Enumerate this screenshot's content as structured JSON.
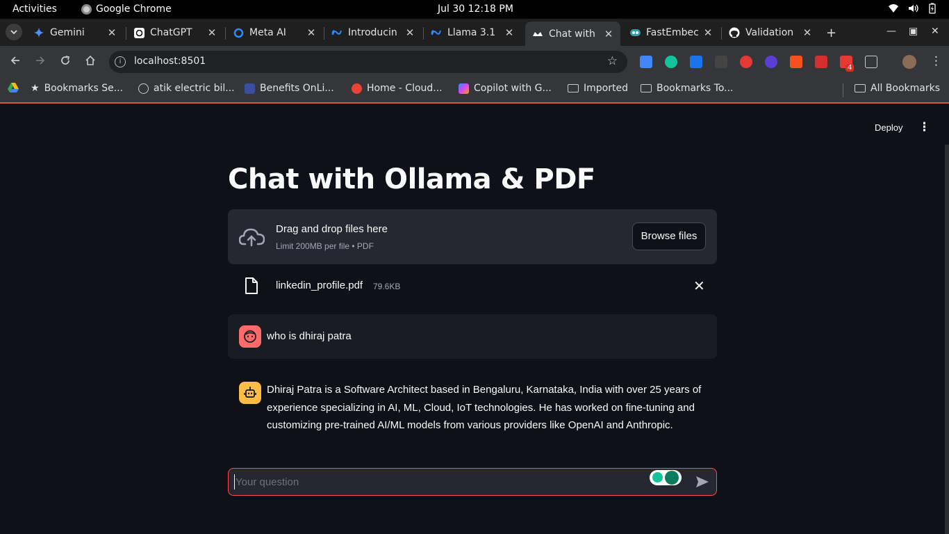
{
  "system": {
    "activities": "Activities",
    "app_name": "Google Chrome",
    "clock": "Jul 30  12:18 PM"
  },
  "browser": {
    "tabs": [
      {
        "title": "Gemini",
        "icon": "gemini-icon"
      },
      {
        "title": "ChatGPT",
        "icon": "chatgpt-icon"
      },
      {
        "title": "Meta AI",
        "icon": "meta-ai-icon"
      },
      {
        "title": "Introducin",
        "icon": "meta-icon"
      },
      {
        "title": "Llama 3.1",
        "icon": "meta-icon"
      },
      {
        "title": "Chat with",
        "icon": "streamlit-icon",
        "active": true
      },
      {
        "title": "FastEmbec",
        "icon": "fastembed-icon"
      },
      {
        "title": "Validation",
        "icon": "github-icon"
      }
    ],
    "url": "localhost:8501",
    "extension_badge": "4",
    "bookmarks": [
      {
        "label": "Bookmarks Se...",
        "icon": "star-icon"
      },
      {
        "label": "atik electric bil...",
        "icon": "globe-icon"
      },
      {
        "label": "Benefits OnLi...",
        "icon": "benefits-icon"
      },
      {
        "label": "Home - Cloud...",
        "icon": "google-cloud-icon"
      },
      {
        "label": "Copilot with G...",
        "icon": "copilot-icon"
      },
      {
        "label": "Imported",
        "icon": "folder-icon"
      },
      {
        "label": "Bookmarks To...",
        "icon": "folder-icon"
      }
    ],
    "all_bookmarks": "All Bookmarks"
  },
  "app": {
    "deploy_label": "Deploy",
    "title": "Chat with Ollama & PDF",
    "uploader": {
      "drag_text": "Drag and drop files here",
      "limit_text": "Limit 200MB per file • PDF",
      "browse_label": "Browse files"
    },
    "file": {
      "name": "linkedin_profile.pdf",
      "size": "79.6KB"
    },
    "messages": [
      {
        "role": "user",
        "text": "who is dhiraj patra"
      },
      {
        "role": "assistant",
        "text": "Dhiraj Patra is a Software Architect based in Bengaluru, Karnataka, India with over 25 years of experience specializing in AI, ML, Cloud, IoT technologies. He has worked on fine-tuning and customizing pre-trained AI/ML models from various providers like OpenAI and Anthropic."
      }
    ],
    "input_placeholder": "Your question"
  },
  "colors": {
    "background": "#0e1117",
    "accent": "#ff4b4b",
    "user_avatar": "#ff6b6b",
    "bot_avatar": "#ffbd45"
  }
}
